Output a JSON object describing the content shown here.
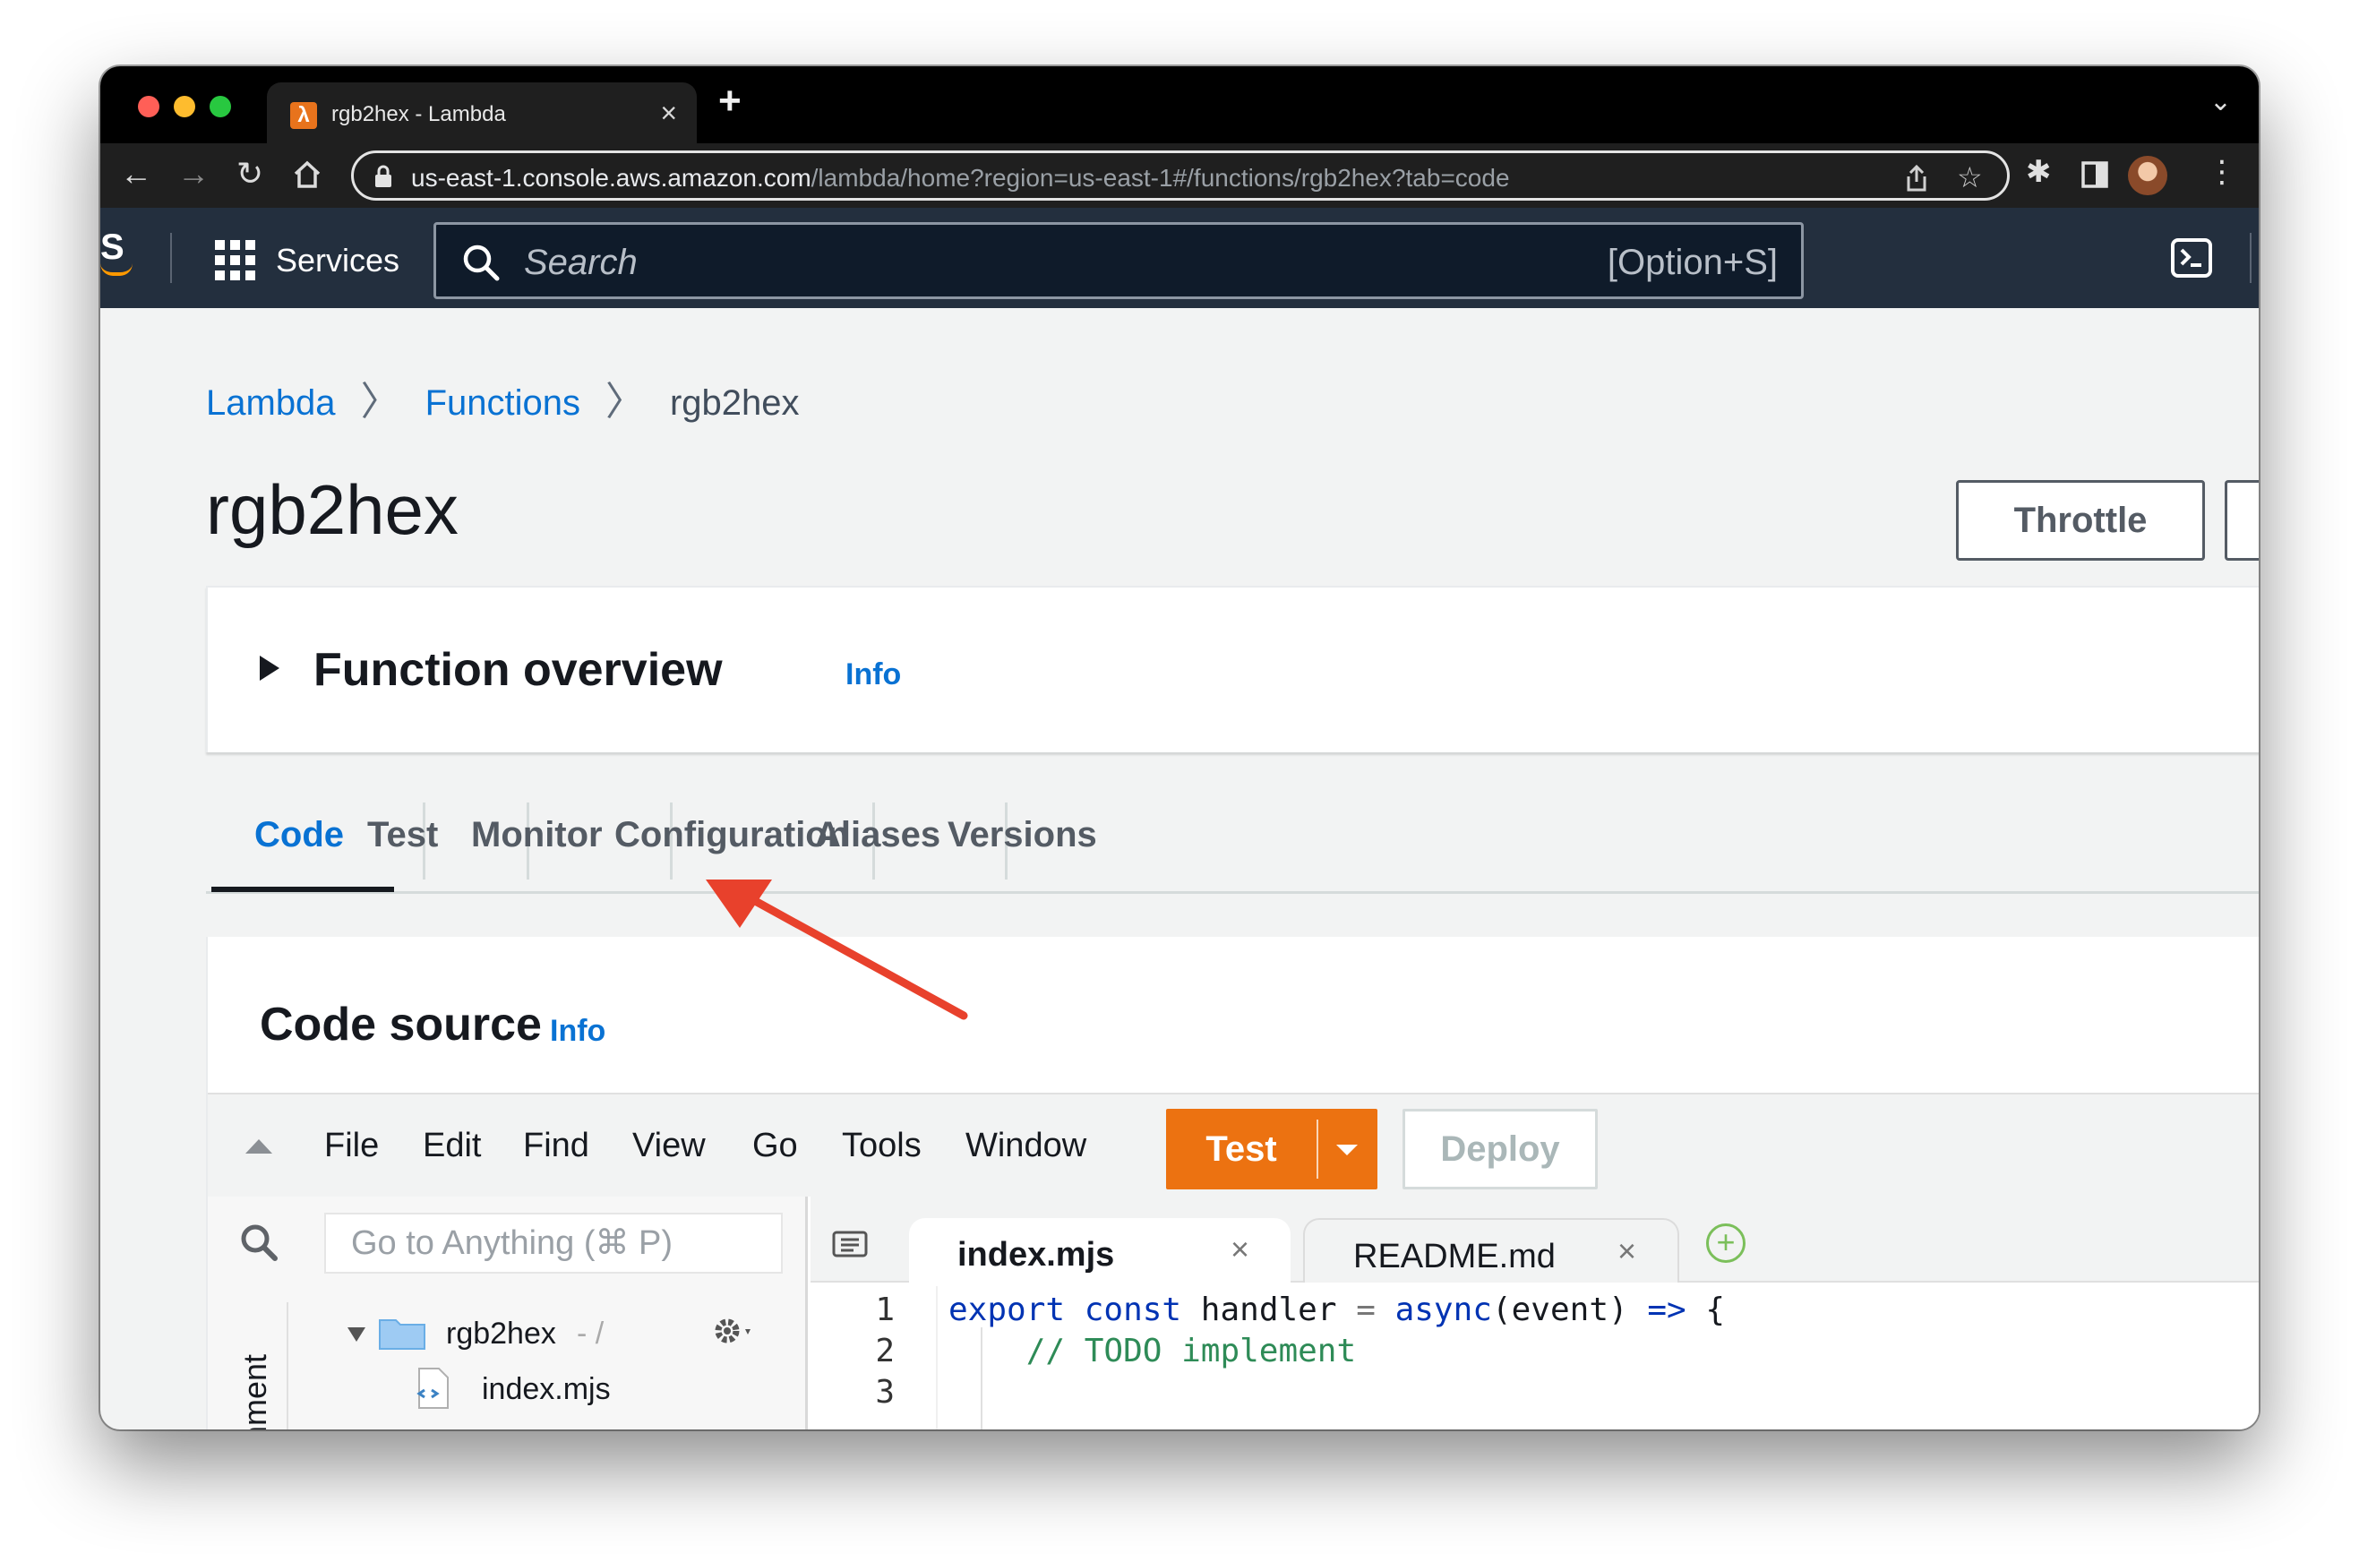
{
  "browser": {
    "tab_title": "rgb2hex - Lambda",
    "url_host": "us-east-1.console.aws.amazon.com",
    "url_path": "/lambda/home?region=us-east-1#/functions/rgb2hex?tab=code"
  },
  "aws_header": {
    "logo_text": "S",
    "services_label": "Services",
    "search_placeholder": "Search",
    "search_shortcut": "[Option+S]"
  },
  "breadcrumb": [
    "Lambda",
    "Functions",
    "rgb2hex"
  ],
  "page": {
    "title": "rgb2hex",
    "throttle_label": "Throttle"
  },
  "overview": {
    "title": "Function overview",
    "info": "Info"
  },
  "tabs": [
    "Code",
    "Test",
    "Monitor",
    "Configuration",
    "Aliases",
    "Versions"
  ],
  "code_source": {
    "title": "Code source",
    "info": "Info",
    "menu": [
      "File",
      "Edit",
      "Find",
      "View",
      "Go",
      "Tools",
      "Window"
    ],
    "test_label": "Test",
    "deploy_label": "Deploy",
    "goto_placeholder": "Go to Anything (⌘ P)",
    "environment_label": "ronment",
    "tree_folder": "rgb2hex",
    "tree_folder_path": "- /",
    "tree_file": "index.mjs",
    "editor_tabs": [
      "index.mjs",
      "README.md"
    ],
    "line_numbers": [
      "1",
      "2",
      "3"
    ],
    "code": {
      "l1_kw1": "export",
      "l1_kw2": "const",
      "l1_name": "handler",
      "l1_eq": "=",
      "l1_async": "async",
      "l1_params": "(event)",
      "l1_arrow": "=>",
      "l1_brace": "{",
      "l2_comment": "// TODO implement"
    }
  },
  "colors": {
    "aws_header": "#232f3e",
    "link_blue": "#0972d3",
    "test_orange": "#ec7211",
    "annotation_arrow": "#e8412c"
  }
}
